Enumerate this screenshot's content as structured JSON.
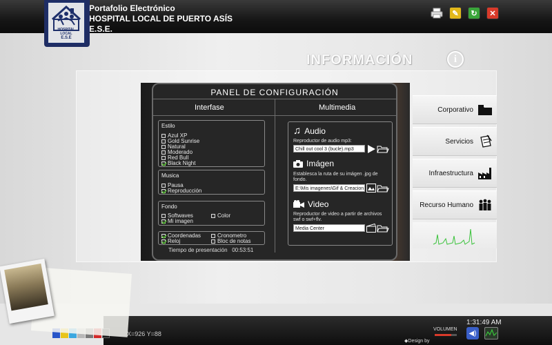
{
  "header": {
    "title_line1": "Portafolio Electrónico",
    "title_line2": "HOSPITAL LOCAL DE PUERTO ASÍS",
    "title_line3": "E.S.E.",
    "logo_text": "HOSPITAL LOCAL",
    "logo_sub": "E.S.E"
  },
  "toolbar": {
    "buttons": [
      "printer-icon",
      "edit-icon",
      "refresh-icon",
      "close-icon"
    ],
    "colors": {
      "edit": "#e2b81a",
      "refresh": "#3aa53a",
      "close": "#d93a2a"
    }
  },
  "section": {
    "title": "INFORMACIÓN",
    "icon": "info-icon",
    "icon_glyph": "i"
  },
  "nav": {
    "items": [
      {
        "label": "Corporativo",
        "icon": "folder-icon"
      },
      {
        "label": "Servicios",
        "icon": "notepad-icon"
      },
      {
        "label": "Infraestructura",
        "icon": "factory-icon"
      },
      {
        "label": "Recurso  Humano",
        "icon": "people-icon"
      }
    ]
  },
  "panel": {
    "title": "PANEL  DE  CONFIGURACIÓN",
    "col_left": "Interfase",
    "col_right": "Multimedia",
    "estilo": {
      "title": "Estilo",
      "options": [
        {
          "label": "Azul  XP",
          "checked": false
        },
        {
          "label": "Gold  Sunrise",
          "checked": false
        },
        {
          "label": "Natural",
          "checked": false
        },
        {
          "label": "Moderado",
          "checked": false
        },
        {
          "label": "Red  Bull",
          "checked": false
        },
        {
          "label": "Black  Night",
          "checked": true
        }
      ]
    },
    "musica": {
      "title": "Musica",
      "options": [
        {
          "label": "Pausa",
          "checked": false
        },
        {
          "label": "Reproducción",
          "checked": true
        }
      ]
    },
    "fondo": {
      "title": "Fondo",
      "options": [
        {
          "label": "Softwaves",
          "checked": false
        },
        {
          "label": "Color",
          "checked": false
        },
        {
          "label": "Mi  imagen",
          "checked": true
        }
      ]
    },
    "extras": {
      "options": [
        {
          "label": "Coordenadas",
          "checked": true
        },
        {
          "label": "Cronometro",
          "checked": false
        },
        {
          "label": "Reloj",
          "checked": true
        },
        {
          "label": "Bloc  de  notas",
          "checked": false
        }
      ]
    },
    "presentation_label": "Tiempo  de  presentación",
    "presentation_time": "00:53:51",
    "audio": {
      "title": "Audio",
      "desc": "Reproductor  de  audio  mp3:",
      "value": "Chill out cool 3 (bucle).mp3"
    },
    "imagen": {
      "title": "Imágen",
      "desc": "Establesca  la  ruta  de  su  imágen  .jpg  de  fondo.",
      "value": "E:\\Mis imagenes\\Gif & Creacion"
    },
    "video": {
      "title": "Video",
      "desc": "Reproductor  de  video  a  partir  de  archivos  swf  o  swf+flv.",
      "value": "Media Center"
    }
  },
  "footer": {
    "coords": "X=926  Y=88",
    "clock": "1:31:49 AM",
    "volume_label": "VOLUMEN",
    "design_label": "Design by",
    "swatches": [
      "#2855c8",
      "#e8c41a",
      "#3aa7e0",
      "#b8b8b8",
      "#7a7a7a",
      "#d42a2a",
      "#1a1a1a"
    ]
  }
}
